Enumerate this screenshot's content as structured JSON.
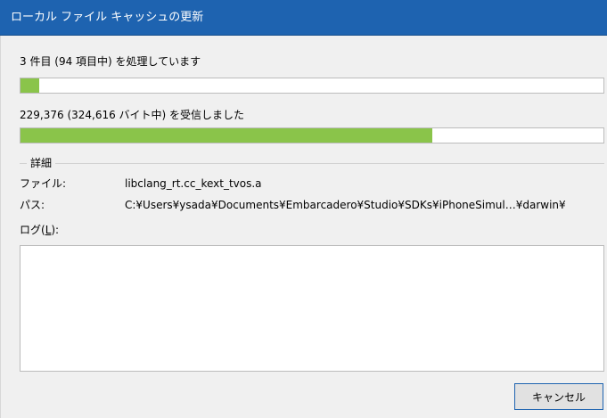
{
  "window": {
    "title": "ローカル ファイル キャッシュの更新"
  },
  "progress_items": {
    "text": "3 件目 (94 項目中) を処理しています",
    "fraction": 0.032
  },
  "progress_bytes": {
    "text": "229,376 (324,616 バイト中) を受信しました",
    "fraction": 0.707
  },
  "details": {
    "legend": "詳細",
    "file_label": "ファイル:",
    "file_value": "libclang_rt.cc_kext_tvos.a",
    "path_label": "パス:",
    "path_value": "C:¥Users¥ysada¥Documents¥Embarcadero¥Studio¥SDKs¥iPhoneSimul…¥darwin¥"
  },
  "log": {
    "label_prefix": "ログ(",
    "label_accel": "L",
    "label_suffix": "):",
    "content": ""
  },
  "buttons": {
    "cancel": "キャンセル"
  },
  "colors": {
    "titlebar": "#1e63b0",
    "progress_fill": "#8ac44a"
  }
}
